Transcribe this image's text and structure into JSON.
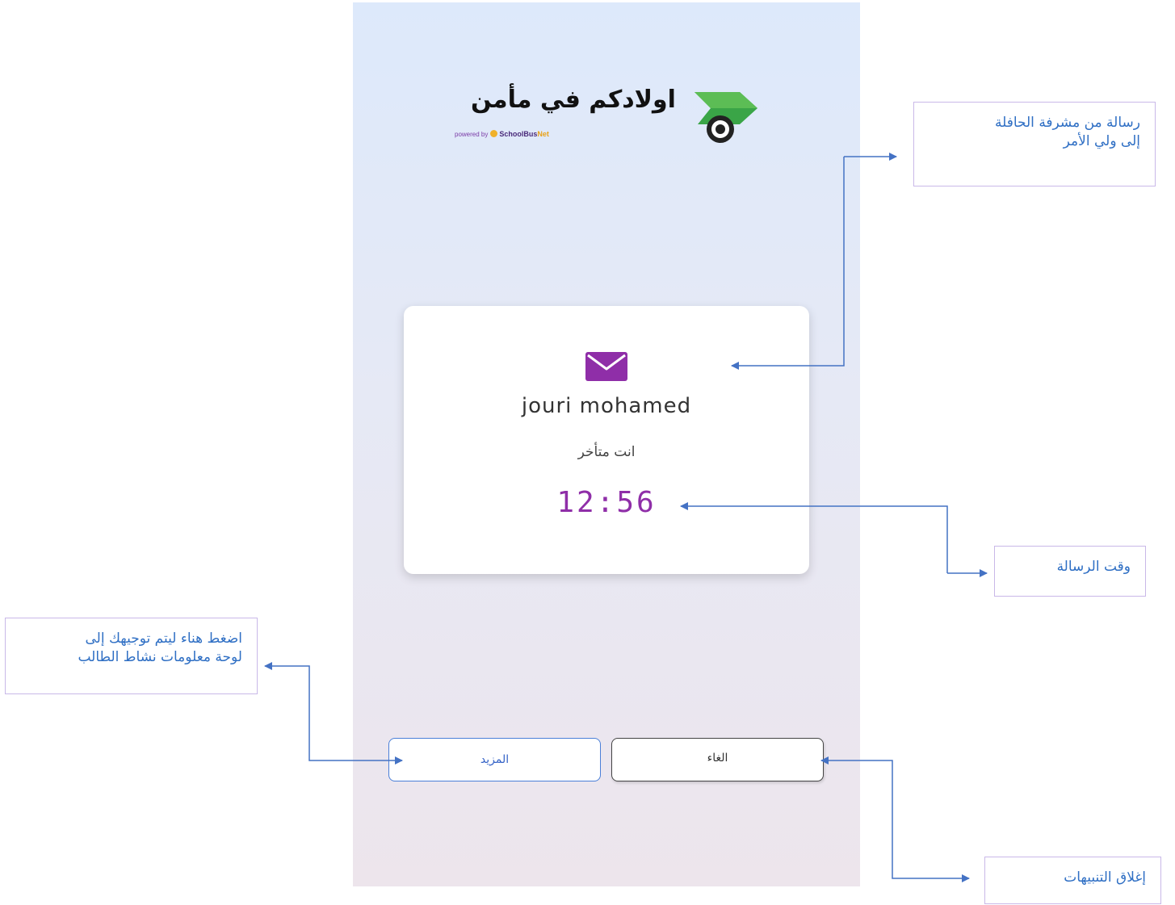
{
  "app": {
    "title": "اولادكم في مأمن",
    "powered_by": "powered by",
    "powered_brand_main": "SchoolBus",
    "powered_brand_suffix": "Net"
  },
  "notification": {
    "icon": "envelope-icon",
    "sender": "jouri mohamed",
    "message": "انت متأخر",
    "time": "12:56"
  },
  "buttons": {
    "more_label": "المزيد",
    "cancel_label": "الغاء"
  },
  "annotations": {
    "message_callout": [
      "رسالة من مشرفة الحافلة",
      "إلى ولي الأمر"
    ],
    "time_callout": "وقت الرسالة",
    "more_callout": [
      "اضغط هناء ليتم توجيهك إلى",
      "لوحة معلومات نشاط الطالب"
    ],
    "cancel_callout": "إغلاق التنبيهات"
  },
  "colors": {
    "accent_purple": "#8f2ea8",
    "logo_green": "#3aa547",
    "button_blue": "#4a7fd8",
    "annotation_blue": "#2f6fc4",
    "connector_blue": "#4472c4"
  }
}
